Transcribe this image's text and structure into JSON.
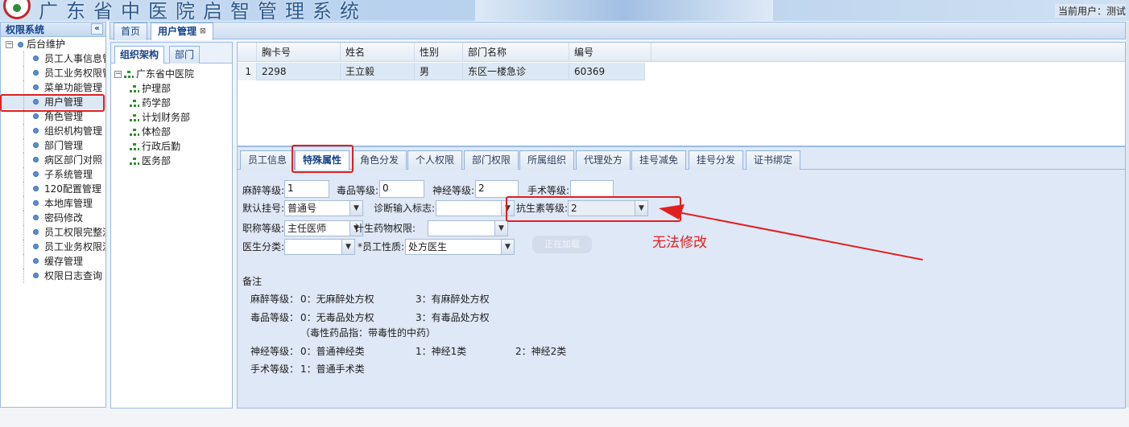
{
  "banner": {
    "title": "广东省中医院启智管理系统",
    "current_user": "当前用户：测试"
  },
  "left_panel": {
    "header": "权限系统",
    "collapse_glyph": "«",
    "root_label": "后台维护",
    "root_toggle": "−",
    "items": [
      {
        "label": "员工人事信息管理"
      },
      {
        "label": "员工业务权限管理"
      },
      {
        "label": "菜单功能管理"
      },
      {
        "label": "用户管理"
      },
      {
        "label": "角色管理"
      },
      {
        "label": "组织机构管理"
      },
      {
        "label": "部门管理"
      },
      {
        "label": "病区部门对照"
      },
      {
        "label": "子系统管理"
      },
      {
        "label": "120配置管理"
      },
      {
        "label": "本地库管理"
      },
      {
        "label": "密码修改"
      },
      {
        "label": "员工权限完整流程"
      },
      {
        "label": "员工业务权限流程"
      },
      {
        "label": "缓存管理"
      },
      {
        "label": "权限日志查询"
      }
    ]
  },
  "top_tabs": [
    {
      "label": "首页"
    },
    {
      "label": "用户管理",
      "close": "⊠"
    }
  ],
  "org_panel": {
    "tabs": [
      {
        "label": "组织架构"
      },
      {
        "label": "部门"
      }
    ],
    "root": "广东省中医院",
    "root_toggle": "−",
    "children": [
      "护理部",
      "药学部",
      "计划财务部",
      "体检部",
      "行政后勤",
      "医务部"
    ]
  },
  "grid": {
    "columns": [
      "胸卡号",
      "姓名",
      "性别",
      "部门名称",
      "编号"
    ],
    "rows": [
      {
        "num": "1",
        "badge": "2298",
        "name": "王立毅",
        "gender": "男",
        "dept": "东区一楼急诊",
        "code": "60369"
      }
    ]
  },
  "detail_tabs": [
    "员工信息",
    "特殊属性",
    "角色分发",
    "个人权限",
    "部门权限",
    "所属组织",
    "代理处方",
    "挂号减免",
    "挂号分发",
    "证书绑定"
  ],
  "form": {
    "anesthesia_label": "麻醉等级:",
    "anesthesia_value": "1",
    "poison_label": "毒品等级:",
    "poison_value": "0",
    "nerve_label": "神经等级:",
    "nerve_value": "2",
    "surgery_label": "手术等级:",
    "surgery_value": "",
    "default_reg_label": "默认挂号:",
    "default_reg_value": "普通号",
    "diag_input_label": "诊断输入标志:",
    "diag_input_value": "",
    "antibiotic_label": "抗生素等级:",
    "antibiotic_value": "2",
    "title_label": "职称等级:",
    "title_value": "主任医师",
    "family_drug_label": "计生药物权限:",
    "family_drug_value": "",
    "doctor_class_label": "医生分类:",
    "doctor_class_value": "",
    "emp_nature_label": "*员工性质:",
    "emp_nature_value": "处方医生",
    "loading_text": "正在加载"
  },
  "notes": {
    "heading": "备注",
    "anesthesia_label": "麻醉等级：",
    "anesthesia_0": "0：无麻醉处方权",
    "anesthesia_3": "3：有麻醉处方权",
    "poison_label": "毒品等级：",
    "poison_0": "0：无毒品处方权",
    "poison_3": "3：有毒品处方权",
    "poison_note": "（毒性药品指：带毒性的中药）",
    "nerve_label": "神经等级：",
    "nerve_0": "0：普通神经类",
    "nerve_1": "1：神经1类",
    "nerve_2": "2：神经2类",
    "surgery_label": "手术等级：",
    "surgery_1": "1：普通手术类"
  },
  "annotation": {
    "text": "无法修改",
    "color": "#e02020"
  },
  "icons": {
    "dropdown": "▼"
  }
}
